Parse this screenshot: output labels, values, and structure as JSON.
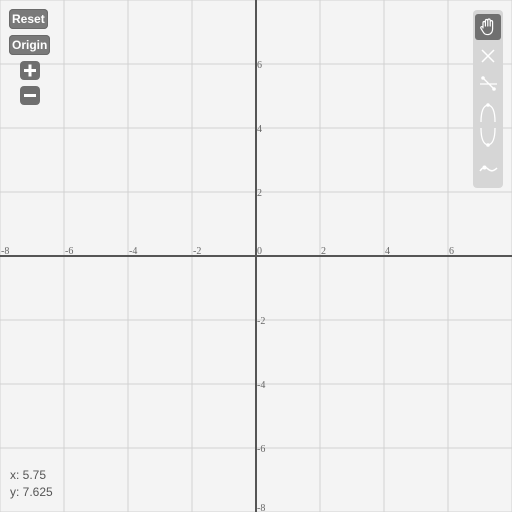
{
  "controls": {
    "reset_label": "Reset",
    "origin_label": "Origin",
    "zoom_in_icon": "plus-icon",
    "zoom_out_icon": "minus-icon"
  },
  "toolbar": {
    "tools": [
      {
        "name": "pan-tool",
        "icon": "hand-icon",
        "active": true
      },
      {
        "name": "line-tool",
        "icon": "lines-crossing-icon",
        "active": false
      },
      {
        "name": "cut-tool",
        "icon": "scissors-icon",
        "active": false
      },
      {
        "name": "parabola-up-tool",
        "icon": "arc-up-icon",
        "active": false
      },
      {
        "name": "parabola-down-tool",
        "icon": "arc-down-icon",
        "active": false
      },
      {
        "name": "curve-tool",
        "icon": "wave-icon",
        "active": false
      }
    ]
  },
  "cursor": {
    "x_text": "x: 5.75",
    "y_text": "y: 7.625"
  },
  "graph": {
    "x_range": [
      -8,
      8
    ],
    "y_range": [
      -8,
      8
    ],
    "grid_step": 2,
    "x_tick_labels": [
      "-8",
      "-6",
      "-4",
      "-2",
      "0",
      "2",
      "4",
      "6"
    ],
    "y_tick_labels": [
      "6",
      "4",
      "2",
      "-2",
      "-4",
      "-6",
      "-8"
    ],
    "colors": {
      "background": "#f4f4f4",
      "grid": "#d2d2d2",
      "axis": "#555555",
      "toolbar": "#d6d6d6",
      "active_tool": "#707070"
    }
  }
}
